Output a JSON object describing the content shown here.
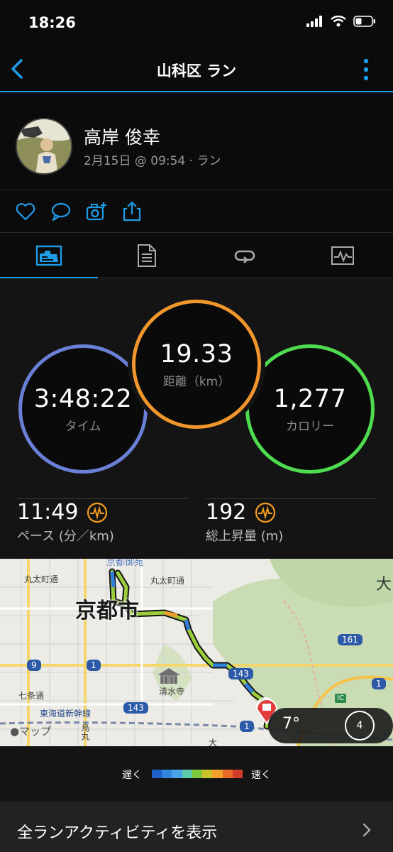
{
  "status": {
    "time": "18:26"
  },
  "nav": {
    "title": "山科区 ラン"
  },
  "profile": {
    "name": "高岸 俊幸",
    "meta": "2月15日 @ 09:54 · ラン"
  },
  "stats": {
    "time": {
      "value": "3:48:22",
      "label": "タイム"
    },
    "distance": {
      "value": "19.33",
      "label": "距離（km）"
    },
    "calories": {
      "value": "1,277",
      "label": "カロリー"
    },
    "pace": {
      "value": "11:49",
      "label": "ペース (分／km)"
    },
    "elevation": {
      "value": "192",
      "label": "総上昇量 (m)"
    }
  },
  "colors": {
    "accent": "#1f9ce8",
    "time_ring": "#6a7fd6",
    "distance_ring": "#f0962c",
    "calories_ring": "#4fdb4f",
    "pulse": "#f29b1d"
  },
  "map": {
    "labels": {
      "city": "京都市",
      "marutamachi1": "丸太町通",
      "marutamachi2": "丸太町通",
      "shichijo": "七条通",
      "kiyomizu": "清水寺",
      "shinkansen": "東海道新幹線",
      "karasuma": "烏丸",
      "top": "京都御苑",
      "dai": "大",
      "dai2": "大",
      "ic": "IC",
      "apple_maps": "マップ"
    },
    "route_shields": [
      "9",
      "1",
      "143",
      "143",
      "1",
      "161",
      "1",
      "1"
    ],
    "weather": {
      "temperature": "7°",
      "wind": "4"
    }
  },
  "legend": {
    "slow": "遅く",
    "fast": "速く",
    "colors": [
      "#1e5fc9",
      "#2f86dc",
      "#4aa3e6",
      "#5cc9a8",
      "#7ec93a",
      "#c8c22b",
      "#f0a02b",
      "#e86a2a",
      "#d23a2a"
    ]
  },
  "footer": {
    "all_runs": "全ランアクティビティを表示"
  }
}
